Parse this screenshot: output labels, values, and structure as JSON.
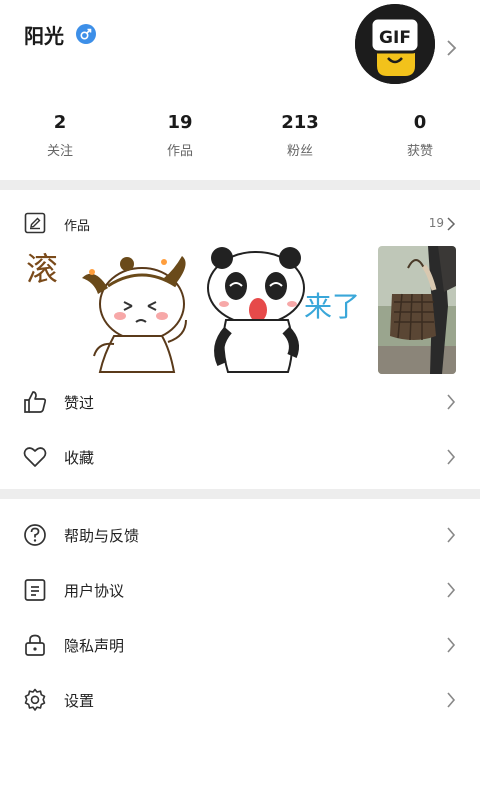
{
  "profile": {
    "username": "阳光",
    "gender_icon": "male-icon",
    "avatar_text": "GIF",
    "accent": "#3d8fe8"
  },
  "stats": [
    {
      "value": "2",
      "label": "关注"
    },
    {
      "value": "19",
      "label": "作品"
    },
    {
      "value": "213",
      "label": "粉丝"
    },
    {
      "value": "0",
      "label": "获赞"
    }
  ],
  "works": {
    "title": "作品",
    "count": "19",
    "thumbnails": [
      {
        "type": "sticker",
        "caption": "滚",
        "icon": "girl-sticker-icon"
      },
      {
        "type": "sticker",
        "caption": "来了",
        "icon": "panda-sticker-icon"
      },
      {
        "type": "photo",
        "icon": "handbag-photo-icon"
      }
    ]
  },
  "menu_top": [
    {
      "label": "赞过",
      "icon": "thumbs-up-icon"
    },
    {
      "label": "收藏",
      "icon": "heart-icon"
    }
  ],
  "menu_bottom": [
    {
      "label": "帮助与反馈",
      "icon": "help-icon"
    },
    {
      "label": "用户协议",
      "icon": "document-icon"
    },
    {
      "label": "隐私声明",
      "icon": "lock-icon"
    },
    {
      "label": "设置",
      "icon": "gear-icon"
    }
  ],
  "colors": {
    "divider": "#ededed",
    "text": "#222222",
    "secondary": "#666666"
  }
}
